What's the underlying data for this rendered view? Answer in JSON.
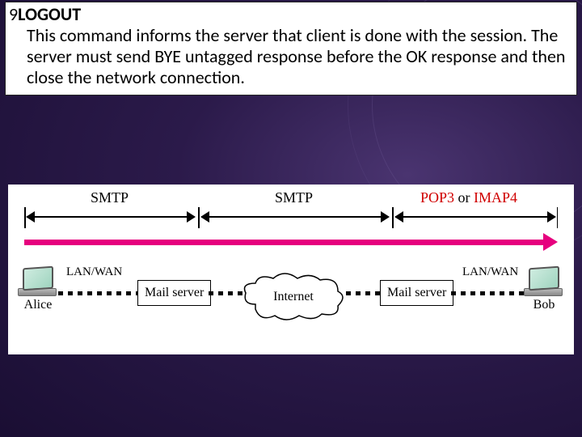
{
  "slide": {
    "number": "9",
    "title": "LOGOUT",
    "body": "This command informs the server that client is done with the session. The server must send BYE untagged response before the OK response and then close the network connection."
  },
  "diagram": {
    "protocols": {
      "seg1": "SMTP",
      "seg2": "SMTP",
      "seg3a": "POP3",
      "seg3_or": " or ",
      "seg3b": "IMAP4"
    },
    "lanwan": "LAN/WAN",
    "mailserver": "Mail server",
    "internet": "Internet",
    "alice": "Alice",
    "bob": "Bob"
  }
}
